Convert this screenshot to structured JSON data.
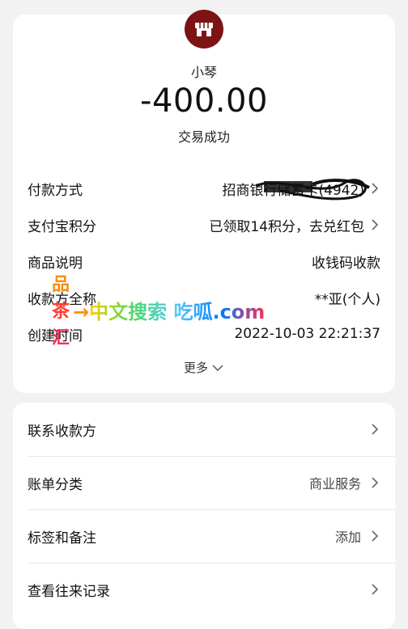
{
  "transaction": {
    "merchant_name": "小琴",
    "amount": "-400.00",
    "status": "交易成功"
  },
  "details": [
    {
      "label": "付款方式",
      "value": "招商银行储蓄卡(4942)",
      "chevron": true
    },
    {
      "label": "支付宝积分",
      "value": "已领取14积分，去兑红包",
      "chevron": true
    },
    {
      "label": "商品说明",
      "value": "收钱码收款",
      "chevron": false
    },
    {
      "label": "收款方全称",
      "value": "**亚(个人)",
      "chevron": false
    },
    {
      "label": "创建时间",
      "value": "2022-10-03 22:21:37",
      "chevron": false
    }
  ],
  "more_label": "更多",
  "actions": [
    {
      "label": "联系收款方",
      "value": ""
    },
    {
      "label": "账单分类",
      "value": "商业服务"
    },
    {
      "label": "标签和备注",
      "value": "添加"
    },
    {
      "label": "查看往来记录",
      "value": ""
    }
  ],
  "watermark": {
    "vertical": [
      "品",
      "茶",
      "汇"
    ],
    "arrow": "→",
    "line": "中文搜索 吃呱.com"
  },
  "colors": {
    "avatar_bg": "#7d1414",
    "background": "#f2f2f2",
    "card": "#ffffff"
  }
}
